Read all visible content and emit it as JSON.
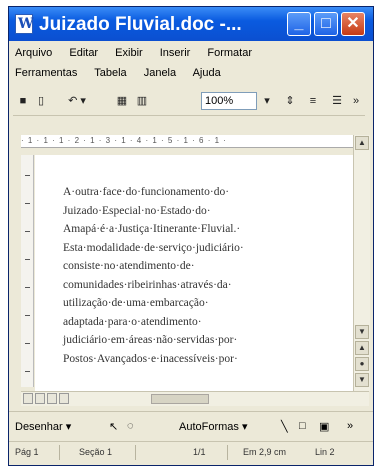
{
  "window": {
    "title": "Juizado Fluvial.doc -..."
  },
  "menu": {
    "row1": [
      "Arquivo",
      "Editar",
      "Exibir",
      "Inserir",
      "Formatar"
    ],
    "row2": [
      "Ferramentas",
      "Tabela",
      "Janela",
      "Ajuda"
    ]
  },
  "toolbar": {
    "zoom": "100%"
  },
  "ruler": {
    "text": "· 1 · 1 · 1 · 2 · 1 · 3 · 1 · 4 · 1 · 5 · 1 · 6 · 1 ·"
  },
  "document": {
    "lines": [
      "A·outra·face·do·funcionamento·do·",
      "Juizado·Especial·no·Estado·do·",
      "Amapá·é·a·Justiça·Itinerante·Fluvial.·",
      "Esta·modalidade·de·serviço·judiciário·",
      "consiste·no·atendimento·de·",
      "comunidades·ribeirinhas·através·da·",
      "utilização·de·uma·embarcação·",
      "adaptada·para·o·atendimento·",
      "judiciário·em·áreas·não·servidas·por·",
      "Postos·Avançados·e·inacessíveis·por·"
    ]
  },
  "drawing": {
    "desenhar": "Desenhar ▾",
    "autoformas": "AutoFormas ▾"
  },
  "status": {
    "page": "Pág 1",
    "section": "Seção 1",
    "pages": "1/1",
    "position": "Em 2,9 cm",
    "line": "Lin 2"
  }
}
